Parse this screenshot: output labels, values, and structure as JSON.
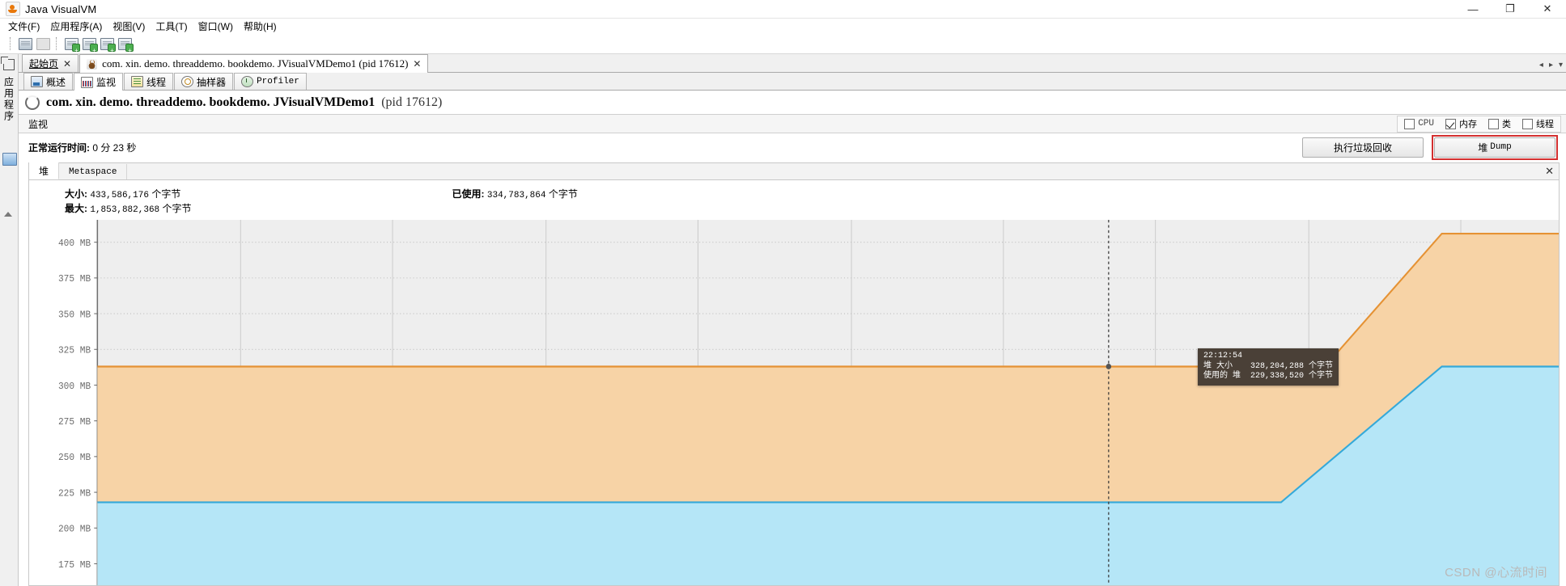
{
  "window": {
    "title": "Java VisualVM",
    "app_icon": "java-visualvm-icon",
    "minimize": "—",
    "maximize": "❐",
    "close": "✕"
  },
  "menubar": {
    "items": [
      {
        "label": "文件(F)",
        "mnemonic": "F"
      },
      {
        "label": "应用程序(A)",
        "mnemonic": "A"
      },
      {
        "label": "视图(V)",
        "mnemonic": "V"
      },
      {
        "label": "工具(T)",
        "mnemonic": "T"
      },
      {
        "label": "窗口(W)",
        "mnemonic": "W"
      },
      {
        "label": "帮助(H)",
        "mnemonic": "H"
      }
    ]
  },
  "toolbar": {
    "buttons": [
      {
        "name": "open-snapshot-icon"
      },
      {
        "name": "save-snapshot-icon"
      },
      {
        "name": "add-remote-host-icon"
      },
      {
        "name": "add-jmx-connection-icon"
      },
      {
        "name": "add-vm-coredump-icon"
      },
      {
        "name": "add-application-snapshot-icon"
      }
    ]
  },
  "leftrail": {
    "label": "应用程序"
  },
  "doctabs": {
    "tabs": [
      {
        "label": "起始页",
        "closable": true,
        "active": false,
        "icon": null
      },
      {
        "label": "com. xin. demo. threaddemo. bookdemo. JVisualVMDemo1  (pid 17612)",
        "closable": true,
        "active": true,
        "icon": "java-coffee-icon"
      }
    ],
    "nav": {
      "prev": "◂",
      "next": "▸",
      "list": "▾"
    }
  },
  "viewtabs": {
    "tabs": [
      {
        "label": "概述",
        "icon": "overview-icon",
        "active": false
      },
      {
        "label": "监视",
        "icon": "monitor-icon",
        "active": true
      },
      {
        "label": "线程",
        "icon": "threads-icon",
        "active": false
      },
      {
        "label": "抽样器",
        "icon": "sampler-icon",
        "active": false
      },
      {
        "label": "Profiler",
        "icon": "profiler-icon",
        "active": false
      }
    ]
  },
  "process": {
    "name": "com. xin. demo. threaddemo. bookdemo. JVisualVMDemo1",
    "pid_text": "(pid 17612)"
  },
  "monitor": {
    "section_title": "监视",
    "checkboxes": [
      {
        "label": "CPU",
        "checked": false,
        "mono": true
      },
      {
        "label": "内存",
        "checked": true,
        "mono": false
      },
      {
        "label": "类",
        "checked": false,
        "mono": false
      },
      {
        "label": "线程",
        "checked": false,
        "mono": false
      }
    ],
    "uptime_label": "正常运行时间:",
    "uptime_value": "0 分 23 秒",
    "gc_button": "执行垃圾回收",
    "heapdump_button_cn": "堆",
    "heapdump_button_en": "Dump",
    "heapdump_highlight_color": "#d32f2f"
  },
  "heap_panel": {
    "tabs": [
      {
        "label": "堆",
        "active": true
      },
      {
        "label": "Metaspace",
        "active": false
      }
    ],
    "close_icon": "✕",
    "stats": [
      {
        "label": "大小:",
        "value": "433,586,176",
        "unit": "个字节"
      },
      {
        "label": "最大:",
        "value": "1,853,882,368",
        "unit": "个字节"
      },
      {
        "label": "已使用:",
        "value": "334,783,864",
        "unit": "个字节"
      }
    ]
  },
  "tooltip": {
    "time": "22:12:54",
    "rows": [
      {
        "label": "堆 大小",
        "value": "328,204,288 个字节"
      },
      {
        "label": "使用的 堆",
        "value": "229,338,520 个字节"
      }
    ]
  },
  "watermark": "CSDN @心流时间",
  "chart_data": {
    "type": "area",
    "title": "堆",
    "xlabel": "",
    "ylabel": "",
    "ylim": [
      160,
      412
    ],
    "ytick_unit": "MB",
    "yticks": [
      400,
      375,
      350,
      325,
      300,
      275,
      250,
      225,
      200,
      175
    ],
    "ytick_labels": [
      "400 MB",
      "375 MB",
      "350 MB",
      "325 MB",
      "300 MB",
      "275 MB",
      "250 MB",
      "225 MB",
      "200 MB",
      "175 MB"
    ],
    "grid": true,
    "legend_position": "none",
    "colors": {
      "heap_size_line": "#e59234",
      "heap_size_fill": "#f7d3a6",
      "heap_used_line": "#35a9d9",
      "heap_used_fill": "#b5e6f7",
      "plot_background": "#eeeeee",
      "gridline": "#c8c8c8",
      "marker": "#555555",
      "tooltip_background": "#4a4037"
    },
    "series": [
      {
        "name": "堆 大小",
        "unit": "MB",
        "x": [
          0,
          0.84,
          0.92,
          1.0
        ],
        "values": [
          313,
          313,
          406,
          406
        ]
      },
      {
        "name": "使用的 堆",
        "unit": "MB",
        "x": [
          0,
          0.81,
          0.92,
          1.0
        ],
        "values": [
          218,
          218,
          313,
          313
        ]
      }
    ],
    "cursor": {
      "x_fraction": 0.692,
      "marker_value": 313,
      "time": "22:12:54",
      "heap_size_bytes": "328,204,288",
      "heap_used_bytes": "229,338,520"
    },
    "vertical_gridlines_x_fraction": [
      0.098,
      0.202,
      0.307,
      0.411,
      0.516,
      0.62,
      0.724,
      0.829,
      0.933
    ]
  }
}
